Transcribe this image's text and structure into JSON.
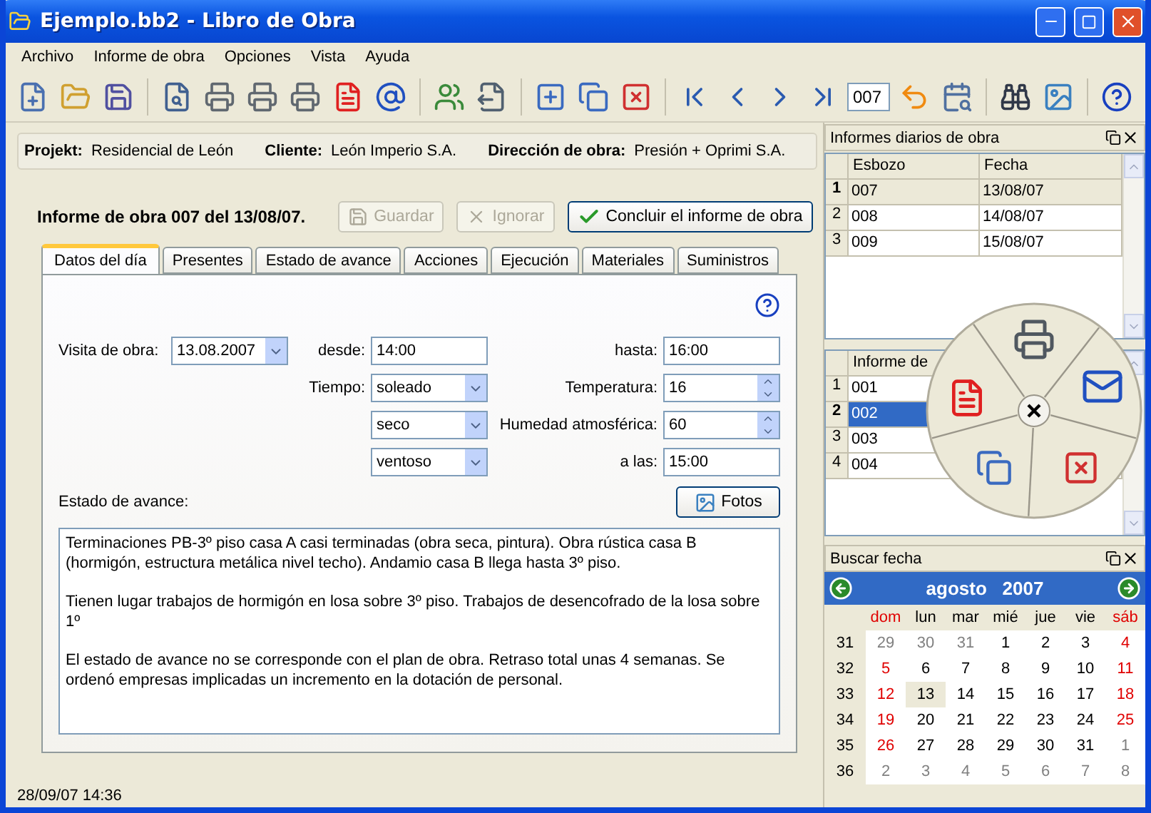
{
  "window": {
    "title": "Ejemplo.bb2 - Libro de Obra"
  },
  "menu": [
    "Archivo",
    "Informe de obra",
    "Opciones",
    "Vista",
    "Ayuda"
  ],
  "toolbar": {
    "page_field": "007"
  },
  "project": [
    {
      "label": "Projekt:",
      "value": "Residencial de León"
    },
    {
      "label": "Cliente:",
      "value": "León Imperio S.A."
    },
    {
      "label": "Dirección de obra:",
      "value": "Presión + Oprimi S.A."
    }
  ],
  "report": {
    "title": "Informe de obra 007 del 13/08/07.",
    "buttons": [
      {
        "label": "Guardar",
        "kind": "save",
        "disabled": true
      },
      {
        "label": "Ignorar",
        "kind": "discard",
        "disabled": true
      },
      {
        "label": "Concluir el informe de obra",
        "kind": "conclude",
        "disabled": false
      }
    ]
  },
  "tabs": [
    {
      "label": "Datos del día",
      "selected": true
    },
    {
      "label": "Presentes",
      "selected": false
    },
    {
      "label": "Estado de avance",
      "selected": false
    },
    {
      "label": "Acciones",
      "selected": false
    },
    {
      "label": "Ejecución",
      "selected": false
    },
    {
      "label": "Materiales",
      "selected": false
    },
    {
      "label": "Suministros",
      "selected": false
    }
  ],
  "form": {
    "visit": {
      "label": "Visita de obra:",
      "value": "13.08.2007"
    },
    "from": {
      "label": "desde:",
      "value": "14:00"
    },
    "to": {
      "label": "hasta:",
      "value": "16:00"
    },
    "weather": {
      "label": "Tiempo:",
      "values": [
        "soleado",
        "seco",
        "ventoso"
      ]
    },
    "temperature": {
      "label": "Temperatura:",
      "value": "16"
    },
    "humidity": {
      "label": "Humedad atmosférica:",
      "value": "60"
    },
    "at": {
      "label": "a las:",
      "value": "15:00"
    },
    "progress_label": "Estado de avance:",
    "photos_button": "Fotos",
    "notes": [
      "Terminaciones PB-3º piso casa A casi terminadas (obra seca, pintura). Obra rústica casa B (hormigón, estructura metálica nivel techo). Andamio casa B llega hasta 3º piso.",
      "Tienen lugar trabajos de hormigón en losa sobre 3º piso. Trabajos de desencofrado de la losa sobre 1º",
      "El estado de avance no se corresponde con el plan de obra. Retraso total unas 4 semanas. Se ordenó empresas implicadas un incremento en la dotación de personal."
    ]
  },
  "daily_reports": {
    "title": "Informes diarios de obra",
    "active": false,
    "columns": [
      "Esbozo",
      "Fecha"
    ],
    "rows": [
      {
        "number": "1",
        "cells": [
          "007",
          "13/08/07"
        ],
        "selected": true
      },
      {
        "number": "2",
        "cells": [
          "008",
          "14/08/07"
        ],
        "selected": false
      },
      {
        "number": "3",
        "cells": [
          "009",
          "15/08/07"
        ],
        "selected": false
      }
    ]
  },
  "reports": {
    "active": true,
    "columns": [
      "Informe de"
    ],
    "rows": [
      {
        "number": "1",
        "cells": [
          "001"
        ],
        "selected": false
      },
      {
        "number": "2",
        "cells": [
          "002"
        ],
        "selected": true
      },
      {
        "number": "3",
        "cells": [
          "003"
        ],
        "selected": false
      },
      {
        "number": "4",
        "cells": [
          "004"
        ],
        "selected": false
      }
    ]
  },
  "calendar": {
    "title": "Buscar fecha",
    "month": "agosto",
    "year": "2007",
    "weekdays": [
      {
        "label": "dom",
        "weekend": true
      },
      {
        "label": "lun",
        "weekend": false
      },
      {
        "label": "mar",
        "weekend": false
      },
      {
        "label": "mié",
        "weekend": false
      },
      {
        "label": "jue",
        "weekend": false
      },
      {
        "label": "vie",
        "weekend": false
      },
      {
        "label": "sáb",
        "weekend": true
      }
    ],
    "weeks": [
      {
        "week": "31",
        "days": [
          {
            "day": "29",
            "kind": "other",
            "selected": false
          },
          {
            "day": "30",
            "kind": "other",
            "selected": false
          },
          {
            "day": "31",
            "kind": "other",
            "selected": false
          },
          {
            "day": "1",
            "kind": "normal",
            "selected": false
          },
          {
            "day": "2",
            "kind": "normal",
            "selected": false
          },
          {
            "day": "3",
            "kind": "normal",
            "selected": false
          },
          {
            "day": "4",
            "kind": "weekend",
            "selected": false
          }
        ]
      },
      {
        "week": "32",
        "days": [
          {
            "day": "5",
            "kind": "weekend",
            "selected": false
          },
          {
            "day": "6",
            "kind": "normal",
            "selected": false
          },
          {
            "day": "7",
            "kind": "normal",
            "selected": false
          },
          {
            "day": "8",
            "kind": "normal",
            "selected": false
          },
          {
            "day": "9",
            "kind": "normal",
            "selected": false
          },
          {
            "day": "10",
            "kind": "normal",
            "selected": false
          },
          {
            "day": "11",
            "kind": "weekend",
            "selected": false
          }
        ]
      },
      {
        "week": "33",
        "days": [
          {
            "day": "12",
            "kind": "weekend",
            "selected": false
          },
          {
            "day": "13",
            "kind": "normal",
            "selected": true
          },
          {
            "day": "14",
            "kind": "normal",
            "selected": false
          },
          {
            "day": "15",
            "kind": "normal",
            "selected": false
          },
          {
            "day": "16",
            "kind": "normal",
            "selected": false
          },
          {
            "day": "17",
            "kind": "normal",
            "selected": false
          },
          {
            "day": "18",
            "kind": "weekend",
            "selected": false
          }
        ]
      },
      {
        "week": "34",
        "days": [
          {
            "day": "19",
            "kind": "weekend",
            "selected": false
          },
          {
            "day": "20",
            "kind": "normal",
            "selected": false
          },
          {
            "day": "21",
            "kind": "normal",
            "selected": false
          },
          {
            "day": "22",
            "kind": "normal",
            "selected": false
          },
          {
            "day": "23",
            "kind": "normal",
            "selected": false
          },
          {
            "day": "24",
            "kind": "normal",
            "selected": false
          },
          {
            "day": "25",
            "kind": "weekend",
            "selected": false
          }
        ]
      },
      {
        "week": "35",
        "days": [
          {
            "day": "26",
            "kind": "weekend",
            "selected": false
          },
          {
            "day": "27",
            "kind": "normal",
            "selected": false
          },
          {
            "day": "28",
            "kind": "normal",
            "selected": false
          },
          {
            "day": "29",
            "kind": "normal",
            "selected": false
          },
          {
            "day": "30",
            "kind": "normal",
            "selected": false
          },
          {
            "day": "31",
            "kind": "normal",
            "selected": false
          },
          {
            "day": "1",
            "kind": "other",
            "selected": false
          }
        ]
      },
      {
        "week": "36",
        "days": [
          {
            "day": "2",
            "kind": "other",
            "selected": false
          },
          {
            "day": "3",
            "kind": "other",
            "selected": false
          },
          {
            "day": "4",
            "kind": "other",
            "selected": false
          },
          {
            "day": "5",
            "kind": "other",
            "selected": false
          },
          {
            "day": "6",
            "kind": "other",
            "selected": false
          },
          {
            "day": "7",
            "kind": "other",
            "selected": false
          },
          {
            "day": "8",
            "kind": "other",
            "selected": false
          }
        ]
      }
    ]
  },
  "status_bar": "28/09/07 14:36"
}
